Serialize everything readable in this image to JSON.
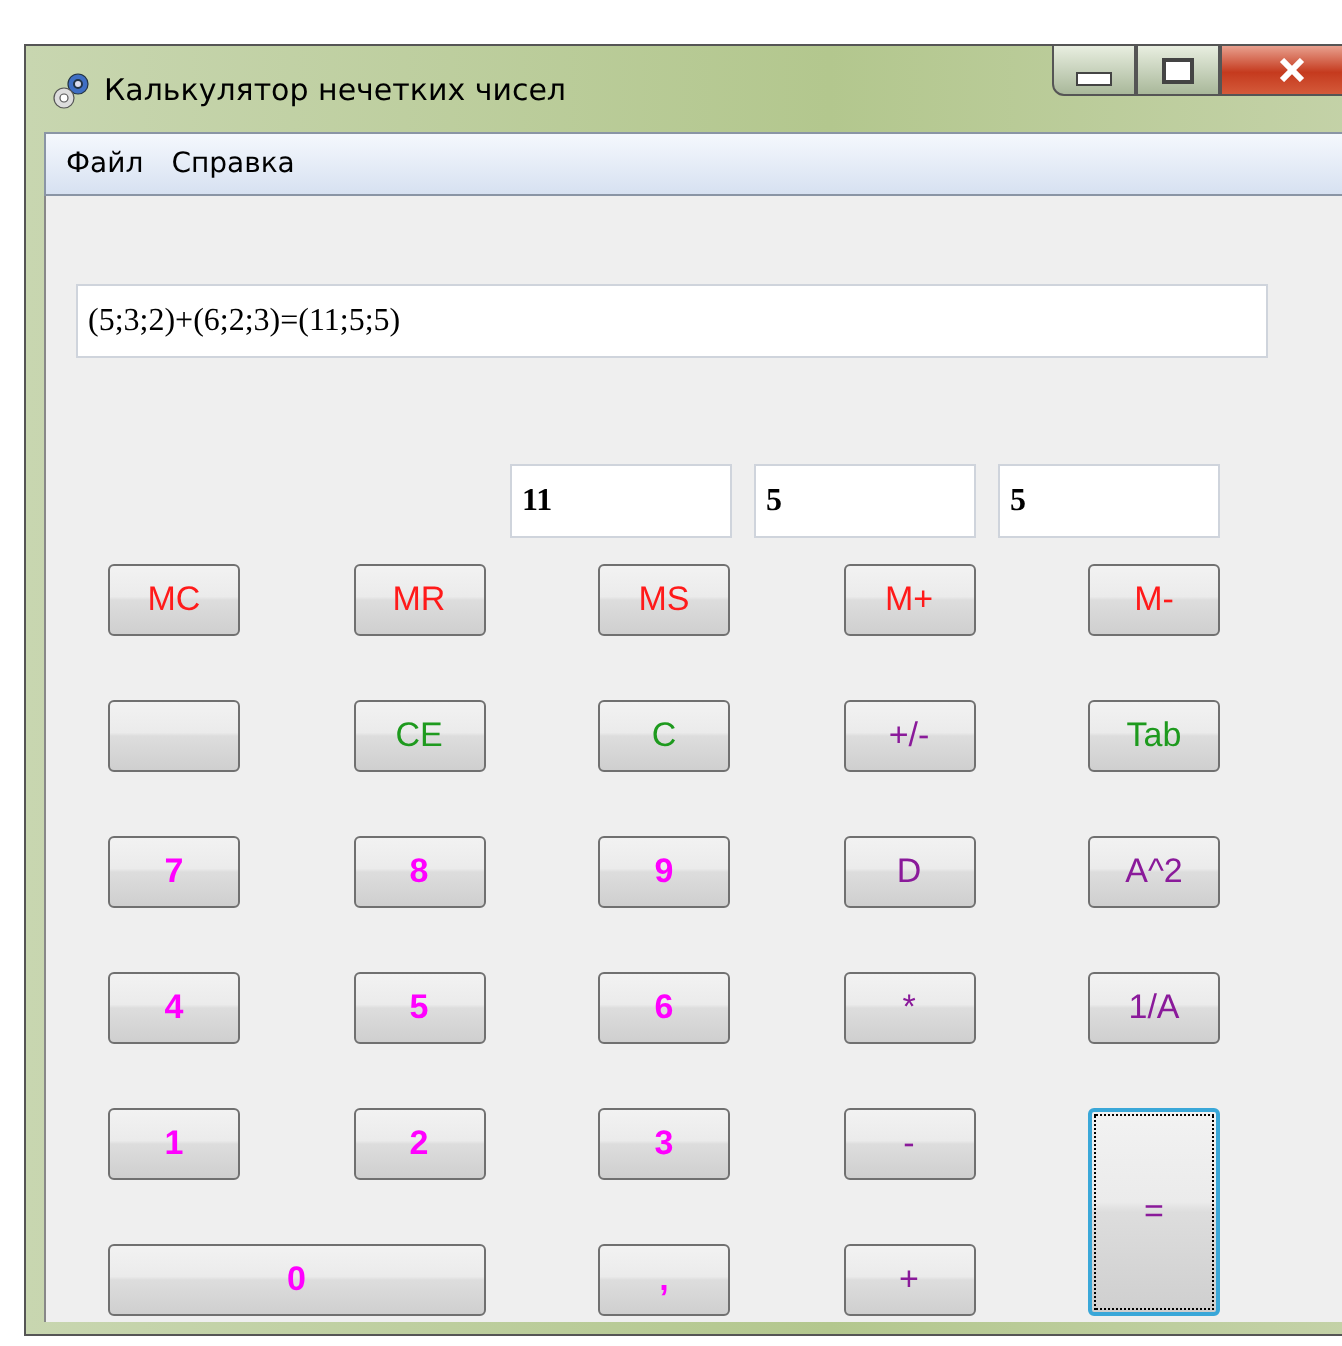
{
  "window": {
    "title": "Калькулятор нечетких чисел"
  },
  "menu": [
    "Файл",
    "Справка"
  ],
  "expression": {
    "value": "(5;3;2)+(6;2;3)=(11;5;5)"
  },
  "components": [
    "11",
    "5",
    "5"
  ],
  "buttons": [
    {
      "label": "MC",
      "kind": "memory",
      "focused": false
    },
    {
      "label": "MR",
      "kind": "memory",
      "focused": false
    },
    {
      "label": "MS",
      "kind": "memory",
      "focused": false
    },
    {
      "label": "M+",
      "kind": "memory",
      "focused": false
    },
    {
      "label": "M-",
      "kind": "memory",
      "focused": false
    },
    {
      "kind": "blank",
      "focused": false
    },
    {
      "label": "CE",
      "kind": "clear",
      "focused": false
    },
    {
      "label": "C",
      "kind": "clear",
      "focused": false
    },
    {
      "label": "+/-",
      "kind": "op",
      "focused": false
    },
    {
      "label": "Tab",
      "kind": "clear",
      "focused": false
    },
    {
      "label": "7",
      "kind": "digit",
      "focused": false
    },
    {
      "label": "8",
      "kind": "digit",
      "focused": false
    },
    {
      "label": "9",
      "kind": "digit",
      "focused": false
    },
    {
      "label": "D",
      "kind": "op",
      "focused": false
    },
    {
      "label": "A^2",
      "kind": "op",
      "focused": false
    },
    {
      "label": "4",
      "kind": "digit",
      "focused": false
    },
    {
      "label": "5",
      "kind": "digit",
      "focused": false
    },
    {
      "label": "6",
      "kind": "digit",
      "focused": false
    },
    {
      "label": "*",
      "kind": "op",
      "focused": false
    },
    {
      "label": "1/A",
      "kind": "op",
      "focused": false
    },
    {
      "label": "1",
      "kind": "digit",
      "focused": false
    },
    {
      "label": "2",
      "kind": "digit",
      "focused": false
    },
    {
      "label": "3",
      "kind": "digit",
      "focused": false
    },
    {
      "label": "-",
      "kind": "op",
      "focused": false
    },
    {
      "label": "=",
      "kind": "op",
      "focused": true,
      "tall": true
    },
    {
      "label": "0",
      "kind": "digit",
      "focused": false,
      "wide": true
    },
    {
      "label": ",",
      "kind": "digit",
      "focused": false
    },
    {
      "label": "+",
      "kind": "op",
      "focused": false
    }
  ]
}
